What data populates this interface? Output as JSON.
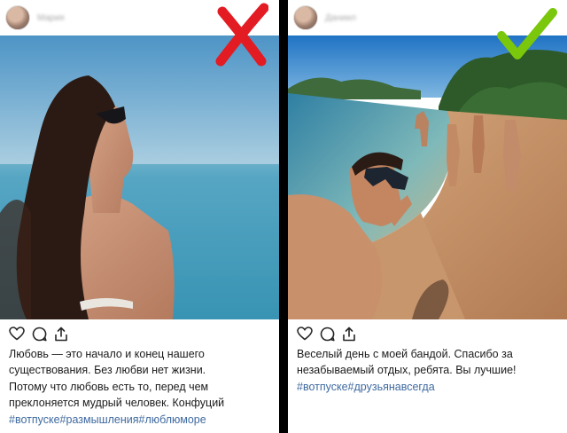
{
  "posts": [
    {
      "id": "bad",
      "username": "Мария",
      "verdict": "cross",
      "verdict_color": "#e31b23",
      "photo_description": "woman-in-sunglasses-at-sea",
      "actions": [
        "heart-icon",
        "comment-icon",
        "share-icon"
      ],
      "caption_lines": [
        "Любовь — это начало и конец нашего",
        "существования. Без любви нет жизни.",
        "Потому что любовь есть то, перед чем",
        "преклоняется мудрый человек. Конфуций"
      ],
      "hashtags": "#вотпуске#размышления#люблюморе"
    },
    {
      "id": "good",
      "username": "Даниил",
      "verdict": "check",
      "verdict_color": "#7ac70c",
      "photo_description": "friends-selfie-on-beach",
      "actions": [
        "heart-icon",
        "comment-icon",
        "share-icon"
      ],
      "caption_lines": [
        "Веселый день с моей бандой. Спасибо за",
        "незабываемый отдых, ребята. Вы лучшие!"
      ],
      "hashtags": "#вотпуске#друзьянавсегда"
    }
  ],
  "colors": {
    "hashtag": "#3f6aa0",
    "text": "#1b1b1b",
    "background": "#ffffff",
    "separator": "#000000"
  }
}
